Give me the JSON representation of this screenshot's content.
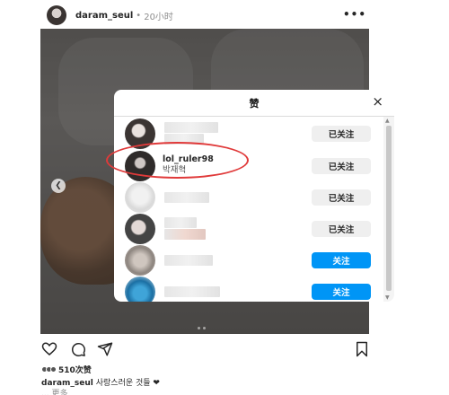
{
  "post": {
    "username": "daram_seul",
    "separator": "•",
    "time": "20小时",
    "more": "•••"
  },
  "modal": {
    "title": "赞",
    "close": "×",
    "rows": [
      {
        "username": "",
        "fullname": "",
        "button": "已关注",
        "state": "following"
      },
      {
        "username": "lol_ruler98",
        "fullname": "박재혁",
        "button": "已关注",
        "state": "following"
      },
      {
        "username": "",
        "fullname": "",
        "button": "已关注",
        "state": "following"
      },
      {
        "username": "",
        "fullname": "",
        "button": "已关注",
        "state": "following"
      },
      {
        "username": "",
        "fullname": "",
        "button": "关注",
        "state": "follow"
      },
      {
        "username": "",
        "fullname": "",
        "button": "关注",
        "state": "follow"
      }
    ]
  },
  "engagement": {
    "likes": "510次赞",
    "caption_user": "daram_seul",
    "caption_text": "사랑스러운 것들 ❤",
    "more": "... 更多"
  },
  "colors": {
    "follow_blue": "#0095f6",
    "following_gray": "#efefef",
    "highlight_red": "#e03a3a"
  }
}
